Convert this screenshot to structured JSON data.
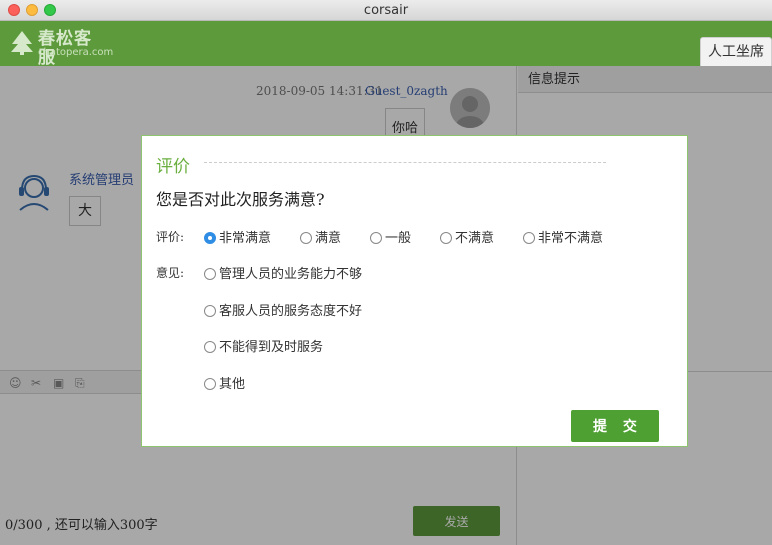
{
  "window": {
    "title": "corsair"
  },
  "header": {
    "logo_name": "春松客服",
    "logo_domain": "chatopera.com",
    "agent_tab": "人工坐席"
  },
  "chat": {
    "message_time": "2018-09-05 14:31:31",
    "message_user": "Guest_0zagth",
    "user_message": "你哈",
    "agent_name": "系统管理员",
    "agent_message": "大",
    "counter_text": "0/300 , 还可以输入300字",
    "send_label": "发送"
  },
  "info_panel": {
    "title": "信息提示"
  },
  "dialog": {
    "title": "评价",
    "question": "您是否对此次服务满意?",
    "rating_label": "评价:",
    "rating_options": [
      "非常满意",
      "满意",
      "一般",
      "不满意",
      "非常不满意"
    ],
    "rating_selected": "非常满意",
    "opinion_label": "意见:",
    "opinion_options": [
      "管理人员的业务能力不够",
      "客服人员的服务态度不好",
      "不能得到及时服务",
      "其他"
    ],
    "submit_label": "提 交"
  },
  "colors": {
    "brand_green": "#5d9a3c",
    "accent_green": "#6aaf3f",
    "radio_selected": "#2f8de4"
  }
}
